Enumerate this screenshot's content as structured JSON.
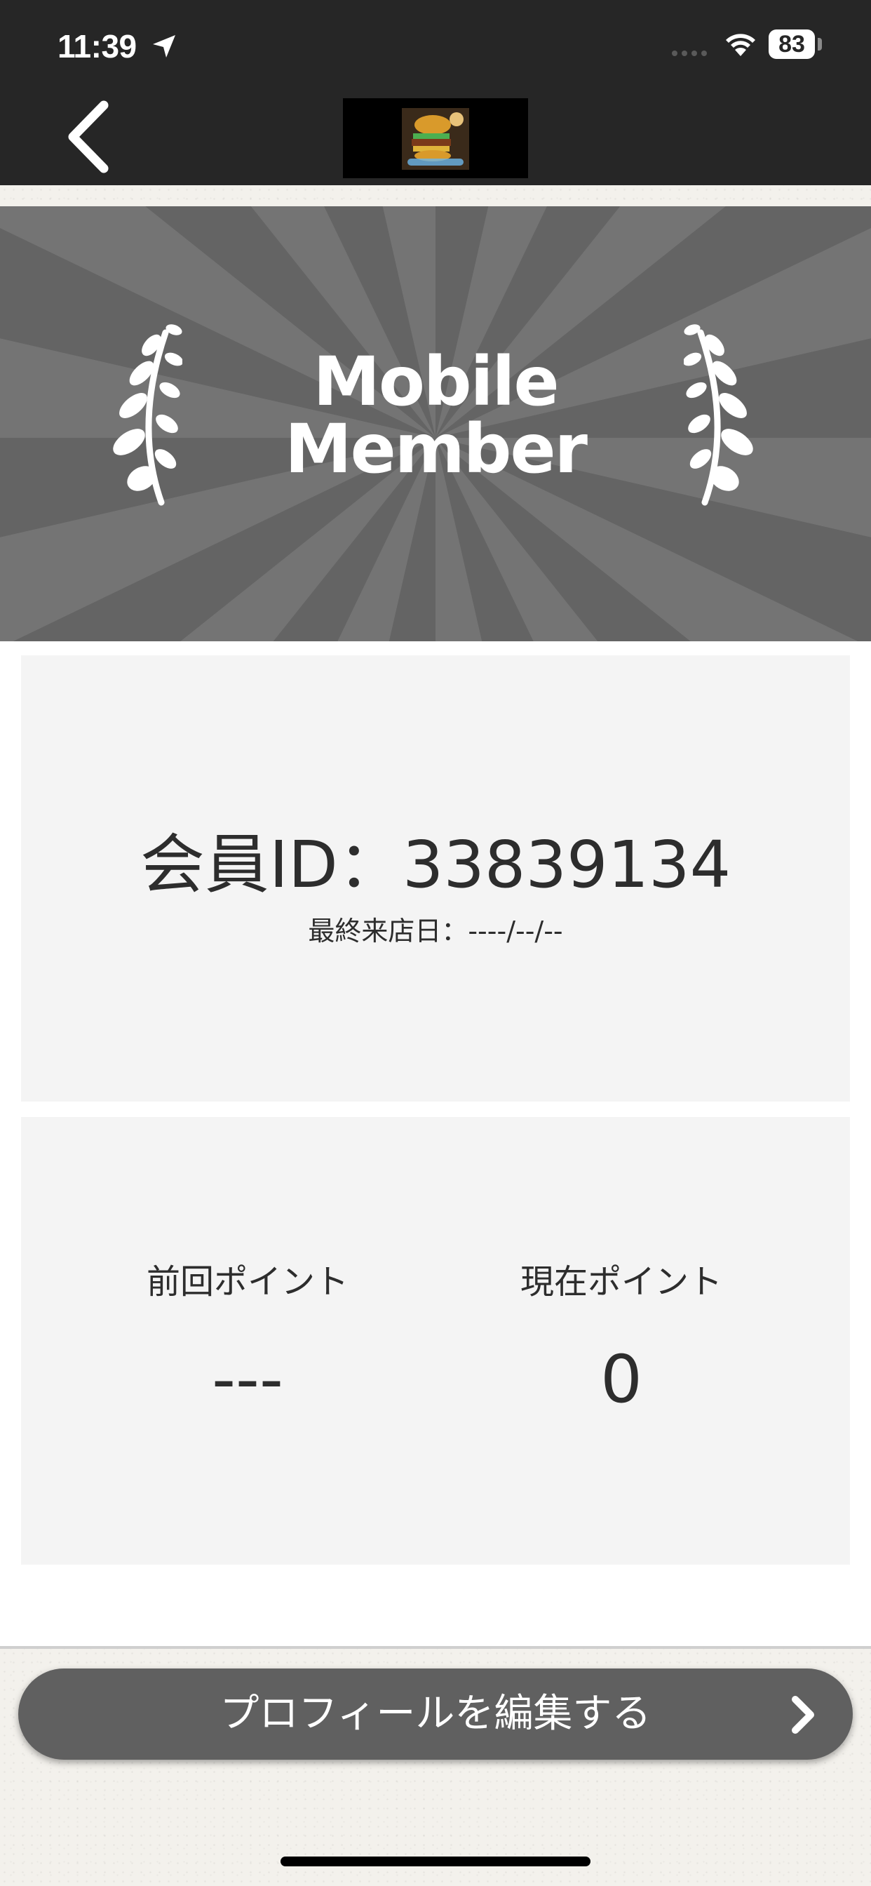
{
  "status_bar": {
    "time": "11:39",
    "battery": "83",
    "icons": [
      "location-arrow-icon",
      "signal-icon",
      "wifi-icon",
      "battery-icon"
    ]
  },
  "nav": {
    "back_icon": "chevron-left-icon",
    "logo": "burger-shop-logo"
  },
  "banner": {
    "title_line1": "Mobile",
    "title_line2": "Member",
    "decoration": "laurel-branch-icon"
  },
  "member": {
    "id_text": "会員ID：33839134",
    "last_visit": "最終来店日：----/--/--"
  },
  "points": {
    "previous_label": "前回ポイント",
    "previous_value": "---",
    "current_label": "現在ポイント",
    "current_value": "0"
  },
  "actions": {
    "edit_profile_label": "プロフィールを編集する",
    "edit_profile_icon": "chevron-right-icon"
  },
  "colors": {
    "topbar": "#262626",
    "banner": "#646464",
    "banner_rays": "#747474",
    "card": "#f4f4f4",
    "button": "#606060",
    "text": "#2d2d2d"
  }
}
